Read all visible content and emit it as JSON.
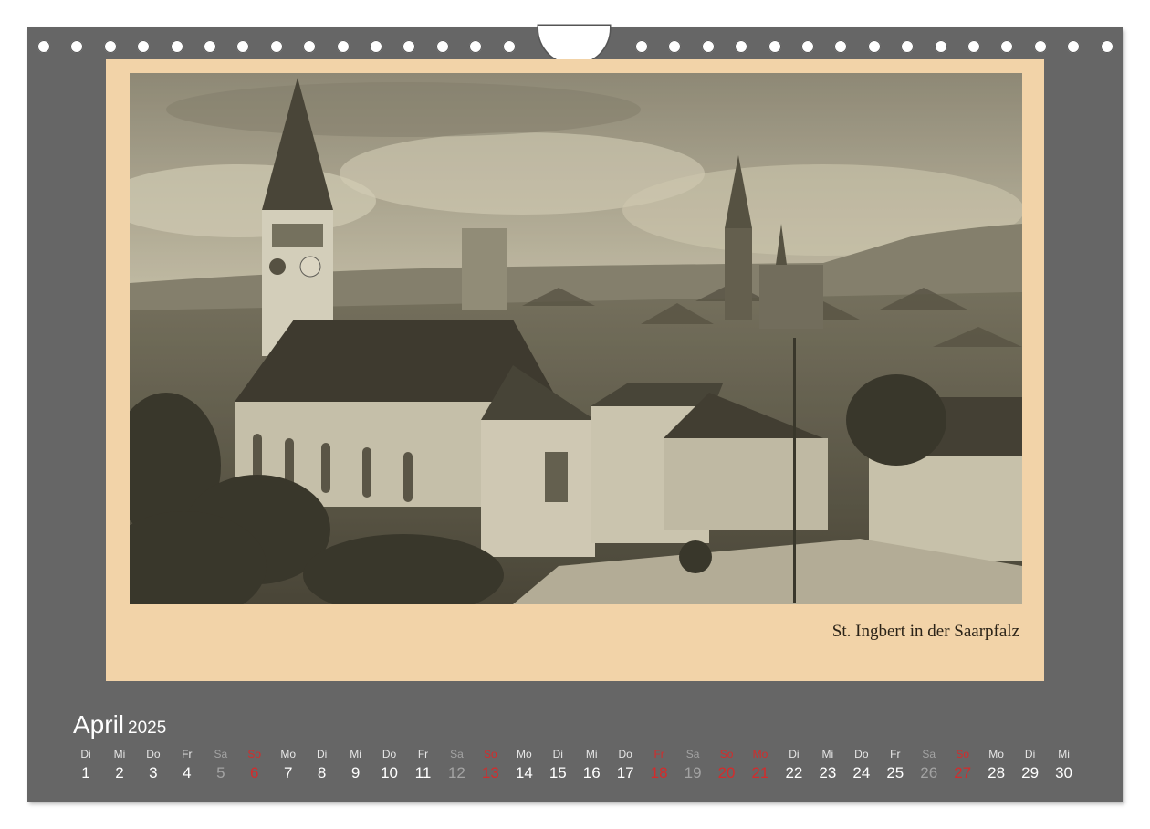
{
  "caption": "St. Ingbert in der Saarpfalz",
  "calendar": {
    "month": "April",
    "year": "2025",
    "days": [
      {
        "abbr": "Di",
        "num": "1",
        "kind": "normal"
      },
      {
        "abbr": "Mi",
        "num": "2",
        "kind": "normal"
      },
      {
        "abbr": "Do",
        "num": "3",
        "kind": "normal"
      },
      {
        "abbr": "Fr",
        "num": "4",
        "kind": "normal"
      },
      {
        "abbr": "Sa",
        "num": "5",
        "kind": "sat"
      },
      {
        "abbr": "So",
        "num": "6",
        "kind": "red"
      },
      {
        "abbr": "Mo",
        "num": "7",
        "kind": "normal"
      },
      {
        "abbr": "Di",
        "num": "8",
        "kind": "normal"
      },
      {
        "abbr": "Mi",
        "num": "9",
        "kind": "normal"
      },
      {
        "abbr": "Do",
        "num": "10",
        "kind": "normal"
      },
      {
        "abbr": "Fr",
        "num": "11",
        "kind": "normal"
      },
      {
        "abbr": "Sa",
        "num": "12",
        "kind": "sat"
      },
      {
        "abbr": "So",
        "num": "13",
        "kind": "red"
      },
      {
        "abbr": "Mo",
        "num": "14",
        "kind": "normal"
      },
      {
        "abbr": "Di",
        "num": "15",
        "kind": "normal"
      },
      {
        "abbr": "Mi",
        "num": "16",
        "kind": "normal"
      },
      {
        "abbr": "Do",
        "num": "17",
        "kind": "normal"
      },
      {
        "abbr": "Fr",
        "num": "18",
        "kind": "red"
      },
      {
        "abbr": "Sa",
        "num": "19",
        "kind": "sat"
      },
      {
        "abbr": "So",
        "num": "20",
        "kind": "red"
      },
      {
        "abbr": "Mo",
        "num": "21",
        "kind": "red"
      },
      {
        "abbr": "Di",
        "num": "22",
        "kind": "normal"
      },
      {
        "abbr": "Mi",
        "num": "23",
        "kind": "normal"
      },
      {
        "abbr": "Do",
        "num": "24",
        "kind": "normal"
      },
      {
        "abbr": "Fr",
        "num": "25",
        "kind": "normal"
      },
      {
        "abbr": "Sa",
        "num": "26",
        "kind": "sat"
      },
      {
        "abbr": "So",
        "num": "27",
        "kind": "red"
      },
      {
        "abbr": "Mo",
        "num": "28",
        "kind": "normal"
      },
      {
        "abbr": "Di",
        "num": "29",
        "kind": "normal"
      },
      {
        "abbr": "Mi",
        "num": "30",
        "kind": "normal"
      }
    ]
  },
  "colors": {
    "frame": "#666666",
    "mat": "#f2d3a8",
    "holiday_red": "#d32c2c",
    "saturday_gray": "#a3a3a3"
  }
}
